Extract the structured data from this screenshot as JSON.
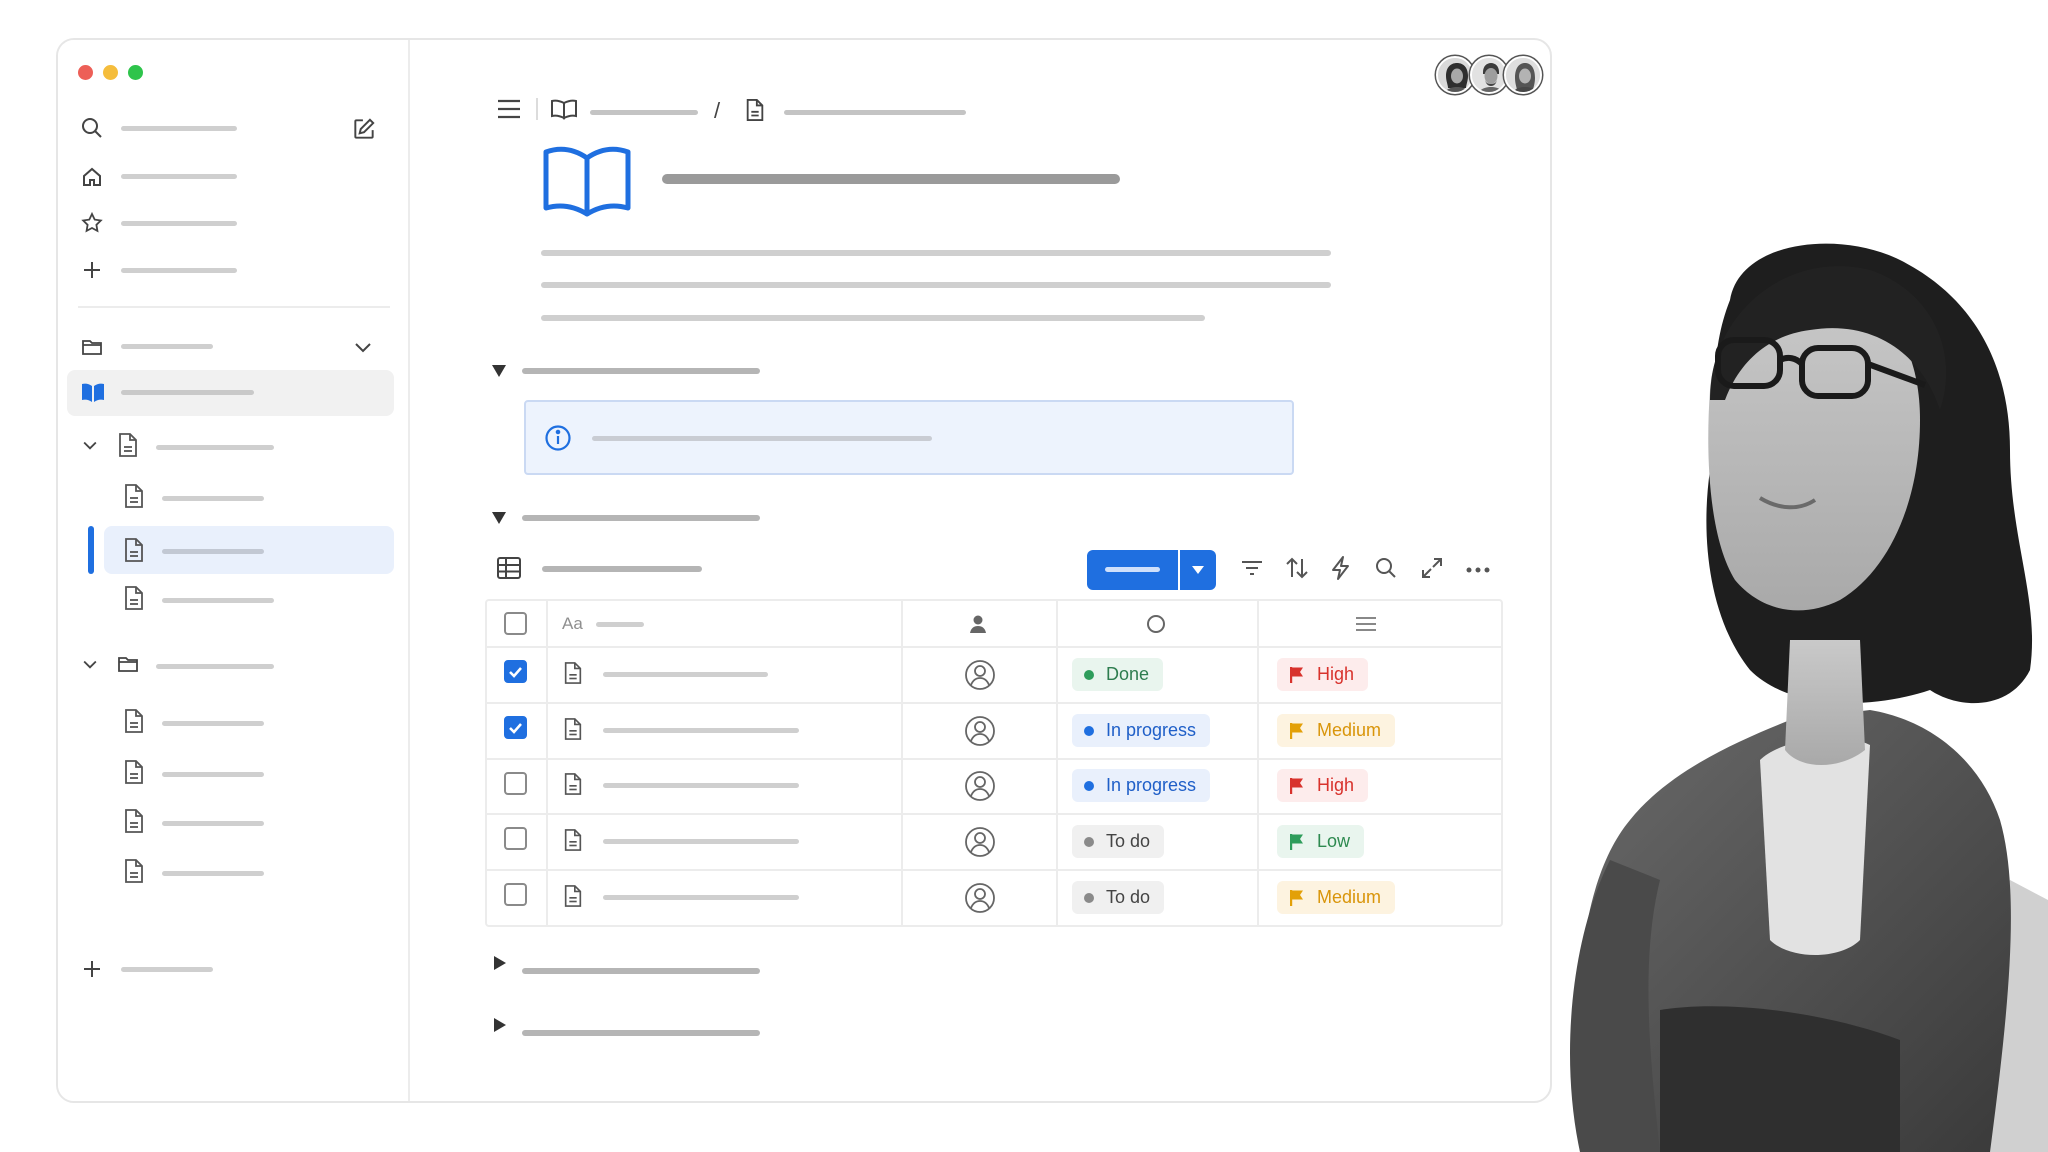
{
  "window": {
    "traffic_lights": [
      "#ed5f57",
      "#f5bd3c",
      "#2ec44b"
    ]
  },
  "sidebar": {
    "top_icons": [
      "search-icon",
      "home-icon",
      "star-icon",
      "plus-icon"
    ],
    "new_page_icon": "compose-icon",
    "section_icon": "folder-icon",
    "active_item_icon": "book-icon"
  },
  "header": {
    "breadcrumb_separator": "/",
    "collaborators": 3,
    "more_icon": "more-horizontal-icon"
  },
  "page": {
    "icon": "book-icon",
    "callout_icon": "info-icon"
  },
  "table": {
    "name_column_prefix": "Aa",
    "column_icons": [
      "person-icon",
      "status-circle-icon",
      "list-icon"
    ],
    "primary_button_icon": "chevron-down-icon",
    "toolbar_icons": [
      "filter-icon",
      "sort-icon",
      "lightning-icon",
      "search-icon",
      "expand-icon",
      "more-horizontal-icon"
    ],
    "rows": [
      {
        "checked": true,
        "status": "Done",
        "priority": "High"
      },
      {
        "checked": true,
        "status": "In progress",
        "priority": "Medium"
      },
      {
        "checked": false,
        "status": "In progress",
        "priority": "High"
      },
      {
        "checked": false,
        "status": "To do",
        "priority": "Low"
      },
      {
        "checked": false,
        "status": "To do",
        "priority": "Medium"
      }
    ]
  },
  "colors": {
    "accent": "#1f6fe0",
    "selected_bg": "#e9f0fc",
    "status_done": "#2e9d5b",
    "status_in_progress": "#1f6fe0",
    "status_todo": "#6b6b6b",
    "priority_high": "#d8322c",
    "priority_medium": "#e3a008",
    "priority_low": "#2e9d5b"
  }
}
